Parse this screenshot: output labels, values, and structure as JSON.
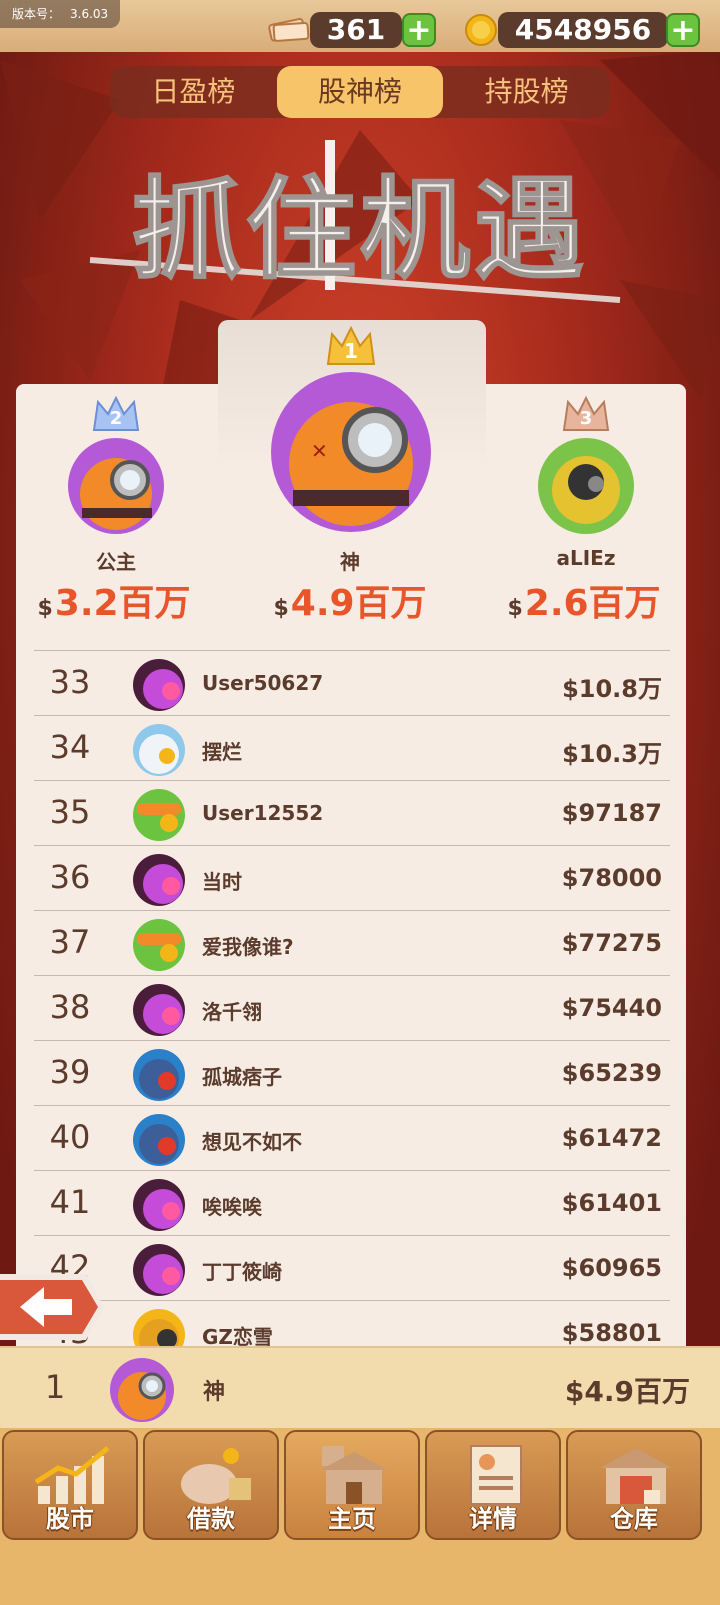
{
  "version": {
    "label": "版本号：",
    "value": "3.6.03"
  },
  "currency": {
    "cash": "361",
    "coins": "4548956"
  },
  "tabs": [
    {
      "label": "日盈榜",
      "active": false
    },
    {
      "label": "股神榜",
      "active": true
    },
    {
      "label": "持股榜",
      "active": false
    }
  ],
  "banner": {
    "title": "抓住机遇"
  },
  "podium": [
    {
      "rank": "1",
      "name": "神",
      "value": "4.9百万",
      "currency": "$",
      "crown": "gold"
    },
    {
      "rank": "2",
      "name": "公主",
      "value": "3.2百万",
      "currency": "$",
      "crown": "blue"
    },
    {
      "rank": "3",
      "name": "aLIEz",
      "value": "2.6百万",
      "currency": "$",
      "crown": "bronze"
    }
  ],
  "rows": [
    {
      "rank": "33",
      "name": "User50627",
      "value": "$10.8万",
      "avatar": "purple-pink"
    },
    {
      "rank": "34",
      "name": "摆烂",
      "value": "$10.3万",
      "avatar": "blue-white"
    },
    {
      "rank": "35",
      "name": "User12552",
      "value": "$97187",
      "avatar": "green-orange"
    },
    {
      "rank": "36",
      "name": "当时",
      "value": "$78000",
      "avatar": "purple-pink"
    },
    {
      "rank": "37",
      "name": "爱我像谁?",
      "value": "$77275",
      "avatar": "green-orange"
    },
    {
      "rank": "38",
      "name": "洛千翎",
      "value": "$75440",
      "avatar": "purple-pink"
    },
    {
      "rank": "39",
      "name": "孤城痞子",
      "value": "$65239",
      "avatar": "blue-red"
    },
    {
      "rank": "40",
      "name": "想见不如不",
      "value": "$61472",
      "avatar": "blue-red"
    },
    {
      "rank": "41",
      "name": "唉唉唉",
      "value": "$61401",
      "avatar": "purple-pink"
    },
    {
      "rank": "42",
      "name": "丁丁筱崎",
      "value": "$60965",
      "avatar": "purple-pink"
    },
    {
      "rank": "43",
      "name": "GZ恋雪",
      "value": "$58801",
      "avatar": "yellow-dark"
    }
  ],
  "me": {
    "rank": "1",
    "name": "神",
    "value": "$4.9百万"
  },
  "nav": [
    {
      "label": "股市",
      "icon": "stock-chart-icon"
    },
    {
      "label": "借款",
      "icon": "piggy-bank-icon"
    },
    {
      "label": "主页",
      "icon": "home-icon"
    },
    {
      "label": "详情",
      "icon": "profile-card-icon"
    },
    {
      "label": "仓库",
      "icon": "warehouse-icon"
    }
  ],
  "colors": {
    "accent": "#e8552b",
    "text": "#5b3b2c",
    "tab_active": "#f8c46a",
    "bg_red": "#a52a1c"
  }
}
